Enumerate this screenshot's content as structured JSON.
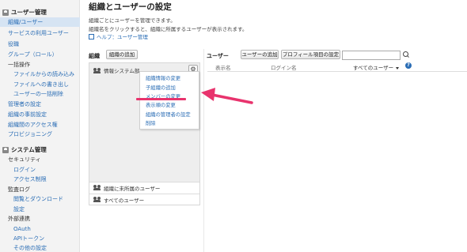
{
  "sidebar": {
    "user_section": "ユーザー管理",
    "items": [
      "組織/ユーザー",
      "サービスの利用ユーザー",
      "役職",
      "グループ（ロール）",
      "一括操作",
      "ファイルからの読み込み",
      "ファイルへの書き出し",
      "ユーザーの一括削除",
      "管理者の設定",
      "組織の事前設定",
      "組織間のアクセス権",
      "プロビジョニング"
    ],
    "system_section": "システム管理",
    "system_items": [
      "セキュリティ",
      "ログイン",
      "アクセス制限",
      "監査ログ",
      "閲覧とダウンロード",
      "設定",
      "外部連携",
      "OAuth",
      "APIトークン",
      "その他の設定"
    ]
  },
  "main": {
    "title": "組織とユーザーの設定",
    "desc1": "組織ごとにユーザーを管理できます。",
    "desc2": "組織名をクリックすると、組織に所属するユーザーが表示されます。",
    "help": "ヘルプ：ユーザー管理"
  },
  "org": {
    "label": "組織",
    "add_button": "組織の追加",
    "selected": "情報システム部",
    "gear": "⚙",
    "unassigned": "組織に未所属のユーザー",
    "all_users": "すべてのユーザー"
  },
  "menu": {
    "items": [
      "組織情報の変更",
      "子組織の追加",
      "メンバーの変更",
      "表示順の変更",
      "組織の管理者の設定",
      "削除"
    ]
  },
  "users": {
    "label": "ユーザー",
    "add_button": "ユーザーの追加",
    "profile_button": "プロフィール項目の設定",
    "search_placeholder": "",
    "col_display_name": "表示名",
    "col_login_name": "ログイン名",
    "col_filter": "すべてのユーザー",
    "help_mark": "?"
  },
  "colors": {
    "link": "#2a6db5",
    "highlight": "#e8336d",
    "active_bg": "#d6e4f3"
  }
}
